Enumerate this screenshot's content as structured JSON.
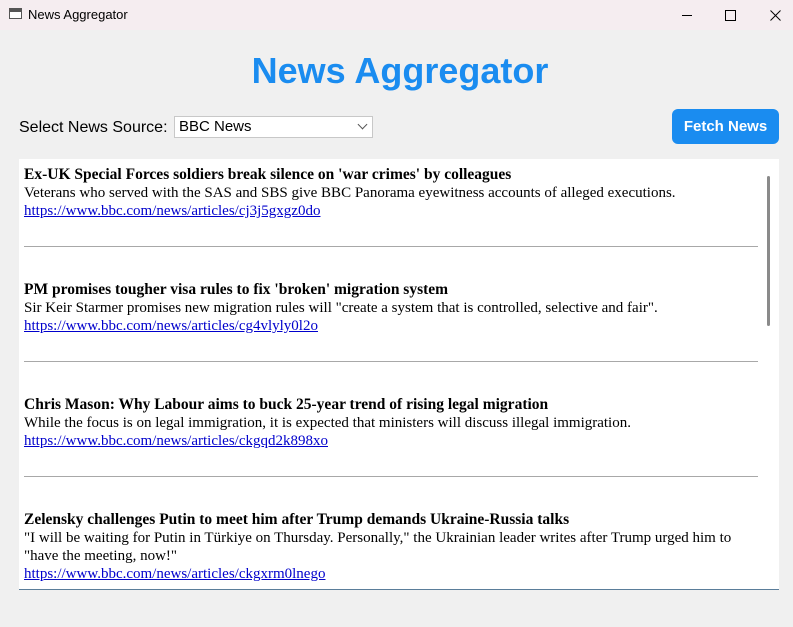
{
  "window": {
    "title": "News Aggregator"
  },
  "header": {
    "title": "News Aggregator"
  },
  "controls": {
    "source_label": "Select News Source:",
    "source_selected": "BBC News",
    "fetch_label": "Fetch News"
  },
  "colors": {
    "accent": "#1a8cf0",
    "link": "#0000cc"
  },
  "articles": [
    {
      "title": "Ex-UK Special Forces soldiers break silence on 'war crimes' by colleagues",
      "description": "Veterans who served with the SAS and SBS give BBC Panorama eyewitness accounts of alleged executions.",
      "url": "https://www.bbc.com/news/articles/cj3j5gxgz0do"
    },
    {
      "title": "PM promises tougher visa rules to fix 'broken' migration system",
      "description": "Sir Keir Starmer promises new migration rules will \"create a system that is controlled, selective and fair\".",
      "url": "https://www.bbc.com/news/articles/cg4vlyly0l2o"
    },
    {
      "title": "Chris Mason: Why Labour aims to buck 25-year trend of rising legal migration",
      "description": "While the focus is on legal immigration, it is expected that ministers will discuss illegal immigration.",
      "url": "https://www.bbc.com/news/articles/ckgqd2k898xo"
    },
    {
      "title": "Zelensky challenges Putin to meet him after Trump demands Ukraine-Russia talks",
      "description": "\"I will be waiting for Putin in Türkiye on Thursday. Personally,\" the Ukrainian leader writes after Trump urged him to \"have the meeting, now!\"",
      "url": "https://www.bbc.com/news/articles/ckgxrm0lnego"
    }
  ]
}
